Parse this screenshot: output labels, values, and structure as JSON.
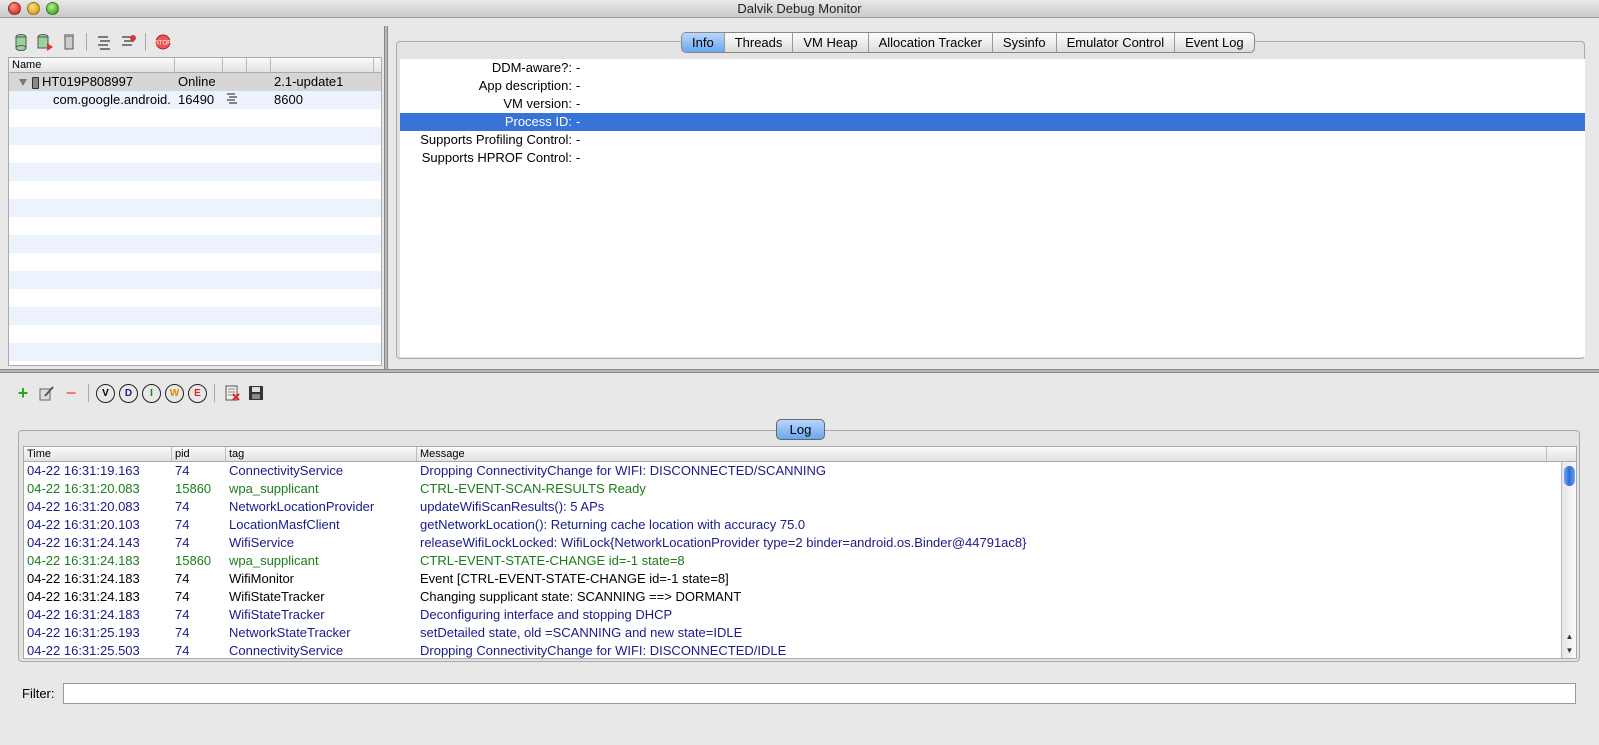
{
  "window": {
    "title": "Dalvik Debug Monitor"
  },
  "devices": {
    "header": [
      "Name",
      "",
      "",
      "",
      ""
    ],
    "rows": [
      {
        "name": "HT019P808997",
        "status": "Online",
        "pid": "",
        "debug": "",
        "version": "2.1-update1"
      },
      {
        "name": "com.google.android.",
        "status": "16490",
        "pid": "",
        "debug": "bug-icon",
        "version": "8600"
      }
    ]
  },
  "tabs": [
    "Info",
    "Threads",
    "VM Heap",
    "Allocation Tracker",
    "Sysinfo",
    "Emulator Control",
    "Event Log"
  ],
  "active_tab": "Info",
  "info": [
    {
      "label": "DDM-aware?:",
      "value": "-"
    },
    {
      "label": "App description:",
      "value": "-"
    },
    {
      "label": "VM version:",
      "value": "-"
    },
    {
      "label": "Process ID:",
      "value": "-"
    },
    {
      "label": "Supports Profiling Control:",
      "value": "-"
    },
    {
      "label": "Supports HPROF Control:",
      "value": "-"
    }
  ],
  "log_levels": [
    "V",
    "D",
    "I",
    "W",
    "E"
  ],
  "log": {
    "tab_label": "Log",
    "columns": [
      "Time",
      "pid",
      "tag",
      "Message"
    ],
    "rows": [
      {
        "time": "04-22 16:31:19.163",
        "pid": "74",
        "tag": "ConnectivityService",
        "msg": "Dropping ConnectivityChange for WIFI: DISCONNECTED/SCANNING",
        "color": "#1a1a8c"
      },
      {
        "time": "04-22 16:31:20.083",
        "pid": "15860",
        "tag": "wpa_supplicant",
        "msg": "CTRL-EVENT-SCAN-RESULTS  Ready",
        "color": "#1a7d1a"
      },
      {
        "time": "04-22 16:31:20.083",
        "pid": "74",
        "tag": "NetworkLocationProvider",
        "msg": "updateWifiScanResults(): 5 APs",
        "color": "#1a1a8c"
      },
      {
        "time": "04-22 16:31:20.103",
        "pid": "74",
        "tag": "LocationMasfClient",
        "msg": "getNetworkLocation(): Returning cache location with accuracy 75.0",
        "color": "#1a1a8c"
      },
      {
        "time": "04-22 16:31:24.143",
        "pid": "74",
        "tag": "WifiService",
        "msg": "releaseWifiLockLocked: WifiLock{NetworkLocationProvider type=2 binder=android.os.Binder@44791ac8}",
        "color": "#1a1a8c"
      },
      {
        "time": "04-22 16:31:24.183",
        "pid": "15860",
        "tag": "wpa_supplicant",
        "msg": "CTRL-EVENT-STATE-CHANGE id=-1 state=8",
        "color": "#1a7d1a"
      },
      {
        "time": "04-22 16:31:24.183",
        "pid": "74",
        "tag": "WifiMonitor",
        "msg": "Event [CTRL-EVENT-STATE-CHANGE id=-1 state=8]",
        "color": "#000000"
      },
      {
        "time": "04-22 16:31:24.183",
        "pid": "74",
        "tag": "WifiStateTracker",
        "msg": "Changing supplicant state: SCANNING ==> DORMANT",
        "color": "#000000"
      },
      {
        "time": "04-22 16:31:24.183",
        "pid": "74",
        "tag": "WifiStateTracker",
        "msg": "Deconfiguring interface and stopping DHCP",
        "color": "#1a1a8c"
      },
      {
        "time": "04-22 16:31:25.193",
        "pid": "74",
        "tag": "NetworkStateTracker",
        "msg": "setDetailed state, old =SCANNING and new state=IDLE",
        "color": "#1a1a8c"
      },
      {
        "time": "04-22 16:31:25.503",
        "pid": "74",
        "tag": "ConnectivityService",
        "msg": "Dropping ConnectivityChange for WIFI: DISCONNECTED/IDLE",
        "color": "#1a1a8c"
      }
    ]
  },
  "filter": {
    "label": "Filter:",
    "value": ""
  }
}
